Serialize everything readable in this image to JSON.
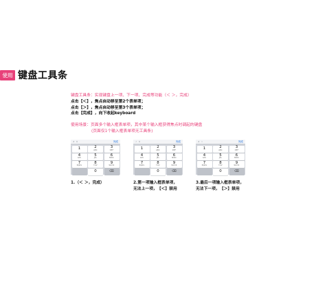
{
  "header": {
    "tag": "使用",
    "title": "键盘工具条"
  },
  "description": {
    "line1": "键盘工具条：实现键盘上一项、下一项、完成等功能（＜ ＞，完成）",
    "line2": "点击【＜】，焦点自动移至第2个表单项；",
    "line3": "点击【＞】，焦点自动移至第3个表单项；",
    "line4": "点击【完成】，向下收起keyboard",
    "line5": "使用场景：页面多个输入框表单项，其中某个输入框获得焦点时调起的键盘",
    "line6": "(页面仅1个输入框表单项无工具条)"
  },
  "keyboard": {
    "done_label": "完成",
    "prev_arrow": "∧",
    "next_arrow": "∨",
    "keys": [
      {
        "num": "1",
        "letters": ""
      },
      {
        "num": "2",
        "letters": "ABC"
      },
      {
        "num": "3",
        "letters": "DEF"
      },
      {
        "num": "4",
        "letters": "GHI"
      },
      {
        "num": "5",
        "letters": "JKL"
      },
      {
        "num": "6",
        "letters": "MNO"
      },
      {
        "num": "7",
        "letters": "PQRS"
      },
      {
        "num": "8",
        "letters": "TUV"
      },
      {
        "num": "9",
        "letters": "WXYZ"
      },
      {
        "num": "",
        "letters": ""
      },
      {
        "num": "0",
        "letters": ""
      },
      {
        "num": "⌫",
        "letters": ""
      }
    ]
  },
  "captions": {
    "c1": "1.（＜ ＞，完成）",
    "c2a": "2.第一项输入框表单项，",
    "c2b": "无法上一项，【＜】禁用",
    "c3a": "3.最后一项输入框表单项，",
    "c3b": "无法下一项，【＞】禁用"
  },
  "colors": {
    "accent": "#e8417a",
    "link": "#2f7be0",
    "keyboard_bg": "#d2d5db"
  }
}
